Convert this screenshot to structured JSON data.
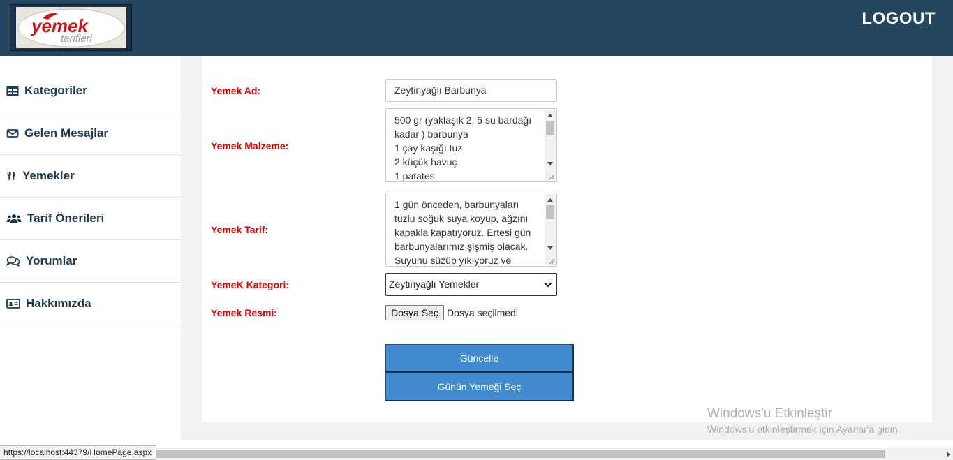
{
  "header": {
    "logo_text_main": "yemek",
    "logo_text_sub": "tarifleri",
    "logout_label": "LOGOUT"
  },
  "sidebar": {
    "items": [
      {
        "label": "Kategoriler",
        "icon": "table-icon"
      },
      {
        "label": "Gelen Mesajlar",
        "icon": "envelope-icon"
      },
      {
        "label": "Yemekler",
        "icon": "utensils-icon"
      },
      {
        "label": "Tarif Önerileri",
        "icon": "users-icon"
      },
      {
        "label": "Yorumlar",
        "icon": "comments-icon"
      },
      {
        "label": "Hakkımızda",
        "icon": "id-card-icon"
      }
    ]
  },
  "form": {
    "name_label": "Yemek Ad:",
    "name_value": "Zeytinyağlı Barbunya",
    "ingredients_label": "Yemek Malzeme:",
    "ingredients_value": "500 gr (yaklaşık 2, 5 su bardağı kadar ) barbunya\n1 çay kaşığı tuz\n2 küçük havuç\n1 patates",
    "recipe_label": "Yemek Tarif:",
    "recipe_value": "1 gün önceden, barbunyaları tuzlu soğuk suya koyup, ağzını kapakla kapatıyoruz. Ertesi gün barbunyalarımız şişmiş olacak. Suyunu süzüp yıkıyoruz ve",
    "category_label": "YemeK Kategori:",
    "category_value": "Zeytinyağlı Yemekler",
    "image_label": "Yemek Resmi:",
    "file_button_label": "Dosya Seç",
    "file_status": "Dosya seçilmedi",
    "update_button": "Güncelle",
    "daily_button": "Günün Yemeği Seç"
  },
  "watermark": {
    "title": "Windows'u Etkinleştir",
    "subtitle": "Windows'u etkinleştirmek için Ayarlar'a gidin."
  },
  "status_bar": {
    "url": "https://localhost:44379/HomePage.aspx"
  },
  "colors": {
    "header_bg": "#24475f",
    "label_red": "#e00000",
    "button_blue": "#418bcf",
    "nav_text": "#1f3b4f"
  }
}
